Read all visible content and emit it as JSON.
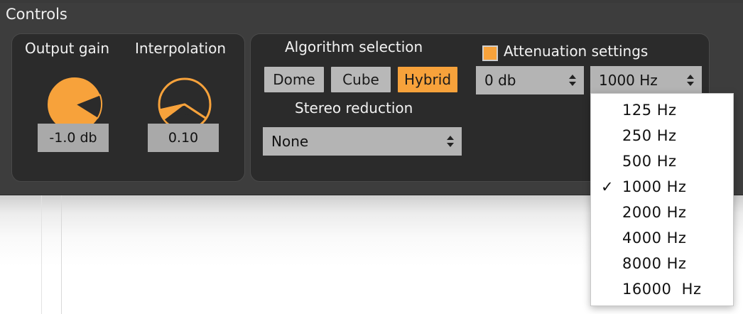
{
  "panel": {
    "title": "Controls"
  },
  "output_gain": {
    "label": "Output gain",
    "value": "-1.0 db"
  },
  "interpolation": {
    "label": "Interpolation",
    "value": "0.10"
  },
  "algorithm": {
    "label": "Algorithm selection",
    "buttons": [
      {
        "label": "Dome",
        "active": false
      },
      {
        "label": "Cube",
        "active": false
      },
      {
        "label": "Hybrid",
        "active": true
      }
    ]
  },
  "stereo_reduction": {
    "label": "Stereo reduction",
    "value": "None"
  },
  "attenuation": {
    "label": "Attenuation settings",
    "enabled": true,
    "level": "0 db",
    "frequency": "1000 Hz"
  },
  "frequency_dropdown": {
    "options": [
      "125 Hz",
      "250 Hz",
      "500 Hz",
      "1000 Hz",
      "2000 Hz",
      "4000 Hz",
      "8000 Hz",
      "16000  Hz"
    ],
    "selected_index": 3,
    "check_glyph": "✓"
  },
  "colors": {
    "accent": "#f7a23b",
    "panel": "#3d3d3d",
    "group": "#2b2b2b"
  }
}
